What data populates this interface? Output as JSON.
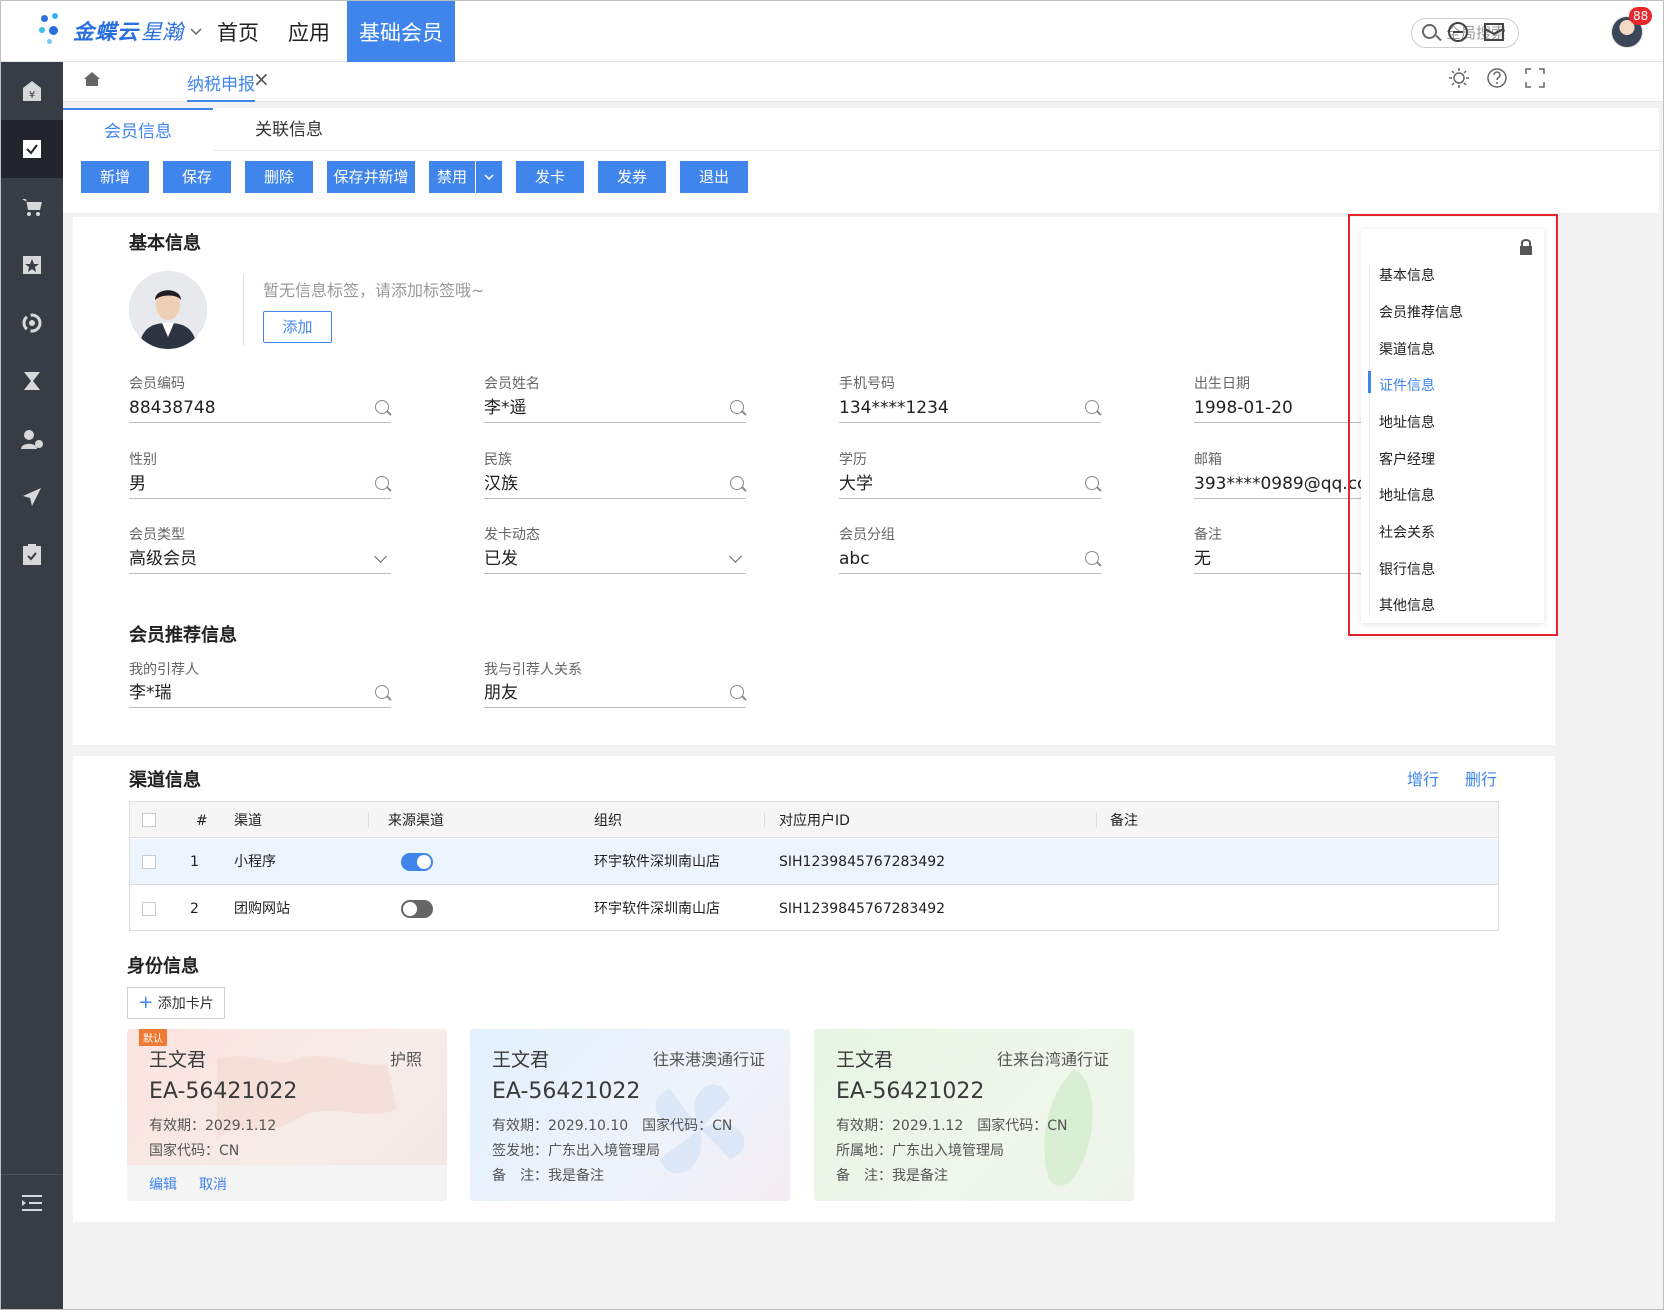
{
  "topbar": {
    "brand": "金蝶云",
    "brand_sub": "星瀚",
    "nav": [
      "首页",
      "应用",
      "基础会员"
    ],
    "search_placeholder": "全局搜索",
    "badge": "88"
  },
  "tabs": {
    "doc": "纳税申报",
    "close": "×"
  },
  "subtabs": [
    "会员信息",
    "关联信息"
  ],
  "toolbar": {
    "buttons": [
      "新增",
      "保存",
      "删除",
      "保存并新增",
      "禁用",
      "发卡",
      "发券",
      "退出"
    ]
  },
  "basic": {
    "title": "基本信息",
    "tag_hint": "暂无信息标签，请添加标签哦~",
    "add_tag": "添加",
    "fields": [
      {
        "label": "会员编码",
        "value": "88438748"
      },
      {
        "label": "会员姓名",
        "value": "李*遥"
      },
      {
        "label": "手机号码",
        "value": "134****1234"
      },
      {
        "label": "出生日期",
        "value": "1998-01-20"
      },
      {
        "label": "性别",
        "value": "男"
      },
      {
        "label": "民族",
        "value": "汉族"
      },
      {
        "label": "学历",
        "value": "大学"
      },
      {
        "label": "邮箱",
        "value": "393****0989@qq.com"
      },
      {
        "label": "会员类型",
        "value": "高级会员"
      },
      {
        "label": "发卡动态",
        "value": "已发"
      },
      {
        "label": "会员分组",
        "value": "abc"
      },
      {
        "label": "备注",
        "value": "无"
      }
    ]
  },
  "recommend": {
    "title": "会员推荐信息",
    "fields": [
      {
        "label": "我的引荐人",
        "value": "李*瑞"
      },
      {
        "label": "我与引荐人关系",
        "value": "朋友"
      }
    ]
  },
  "anchor_nav": {
    "items": [
      "基本信息",
      "会员推荐信息",
      "渠道信息",
      "证件信息",
      "地址信息",
      "客户经理",
      "地址信息",
      "社会关系",
      "银行信息",
      "其他信息"
    ],
    "active_index": 3
  },
  "channel": {
    "title": "渠道信息",
    "add_row": "增行",
    "del_row": "删行",
    "columns": [
      "#",
      "渠道",
      "来源渠道",
      "组织",
      "对应用户ID",
      "备注"
    ],
    "rows": [
      {
        "no": "1",
        "channel": "小程序",
        "source_on": true,
        "org": "环宇软件深圳南山店",
        "uid": "SIH1239845767283492",
        "note": ""
      },
      {
        "no": "2",
        "channel": "团购网站",
        "source_on": false,
        "org": "环宇软件深圳南山店",
        "uid": "SIH1239845767283492",
        "note": ""
      }
    ]
  },
  "identity": {
    "title": "身份信息",
    "add_card": "添加卡片",
    "cards": [
      {
        "default_tag": "默认",
        "name": "王文君",
        "type": "护照",
        "number": "EA-56421022",
        "line1": "有效期：2029.1.12",
        "line2": "国家代码：CN",
        "line3": "",
        "edit": "编辑",
        "cancel": "取消"
      },
      {
        "name": "王文君",
        "type": "往来港澳通行证",
        "number": "EA-56421022",
        "line1": "有效期：2029.10.10　国家代码：CN",
        "line2": "签发地：广东出入境管理局",
        "line3": "备　注：我是备注"
      },
      {
        "name": "王文君",
        "type": "往来台湾通行证",
        "number": "EA-56421022",
        "line1": "有效期：2029.1.12　国家代码：CN",
        "line2": "所属地：广东出入境管理局",
        "line3": "备　注：我是备注"
      }
    ]
  },
  "colors": {
    "accent": "#3f85ec",
    "sidebar": "#383c45",
    "highlight": "#e3262d"
  }
}
